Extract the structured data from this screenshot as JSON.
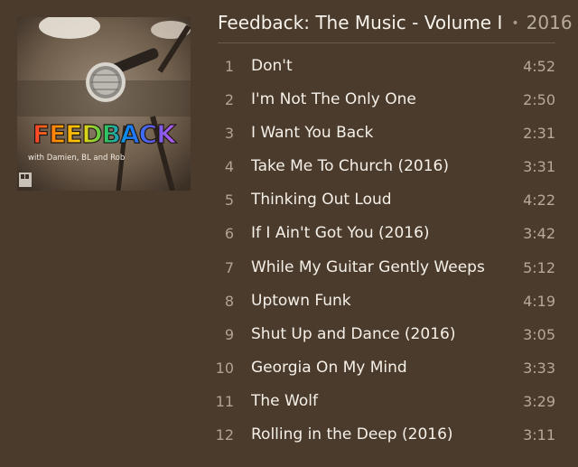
{
  "album": {
    "title": "Feedback: The Music - Volume I",
    "separator": "•",
    "year": "2016",
    "cover_text": "FEEDBACK",
    "cover_subtitle": "with Damien, BL and Rob"
  },
  "tracks": [
    {
      "num": "1",
      "title": "Don't",
      "duration": "4:52"
    },
    {
      "num": "2",
      "title": "I'm Not The Only One",
      "duration": "2:50"
    },
    {
      "num": "3",
      "title": "I Want You Back",
      "duration": "2:31"
    },
    {
      "num": "4",
      "title": "Take Me To Church (2016)",
      "duration": "3:31"
    },
    {
      "num": "5",
      "title": "Thinking Out Loud",
      "duration": "4:22"
    },
    {
      "num": "6",
      "title": "If I Ain't Got You (2016)",
      "duration": "3:42"
    },
    {
      "num": "7",
      "title": "While My Guitar Gently Weeps",
      "duration": "5:12"
    },
    {
      "num": "8",
      "title": "Uptown Funk",
      "duration": "4:19"
    },
    {
      "num": "9",
      "title": "Shut Up and Dance (2016)",
      "duration": "3:05"
    },
    {
      "num": "10",
      "title": "Georgia On My Mind",
      "duration": "3:33"
    },
    {
      "num": "11",
      "title": "The Wolf",
      "duration": "3:29"
    },
    {
      "num": "12",
      "title": "Rolling in the Deep (2016)",
      "duration": "3:11"
    }
  ]
}
